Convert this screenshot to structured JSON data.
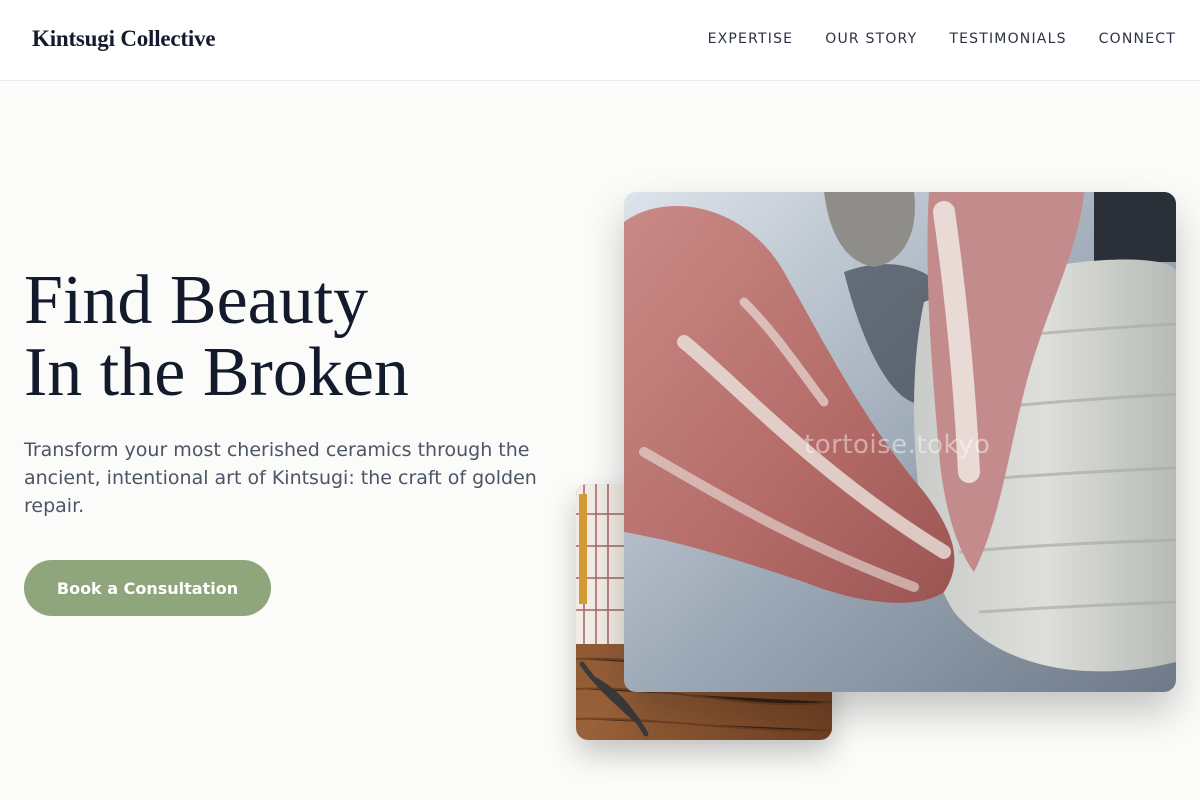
{
  "header": {
    "logo": "Kintsugi Collective",
    "nav": [
      {
        "label": "EXPERTISE"
      },
      {
        "label": "OUR STORY"
      },
      {
        "label": "TESTIMONIALS"
      },
      {
        "label": "CONNECT"
      }
    ]
  },
  "hero": {
    "title_line1": "Find Beauty",
    "title_line2": "In the Broken",
    "subtitle": "Transform your most cherished ceramics through the ancient, intentional art of Kintsugi: the craft of golden repair.",
    "cta_label": "Book a Consultation"
  },
  "images": {
    "main_watermark": "tortoise.tokyo"
  },
  "colors": {
    "accent": "#8fa67c",
    "heading": "#121a2b",
    "body_text": "#4b5565",
    "background": "#fbfbf9"
  }
}
